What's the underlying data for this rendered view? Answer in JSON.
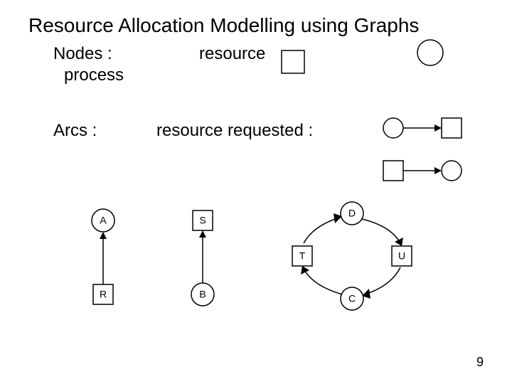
{
  "title": "Resource Allocation Modelling using Graphs",
  "legend": {
    "nodes_label": "Nodes :",
    "process_label": "process",
    "resource_label": "resource",
    "arcs_label": "Arcs :",
    "requested_label": "resource requested :"
  },
  "figures": {
    "a": {
      "top": "A",
      "bottom": "R"
    },
    "b": {
      "top": "S",
      "bottom": "B"
    },
    "c": {
      "d": "D",
      "t": "T",
      "u": "U",
      "c": "C"
    }
  },
  "page_number": "9"
}
